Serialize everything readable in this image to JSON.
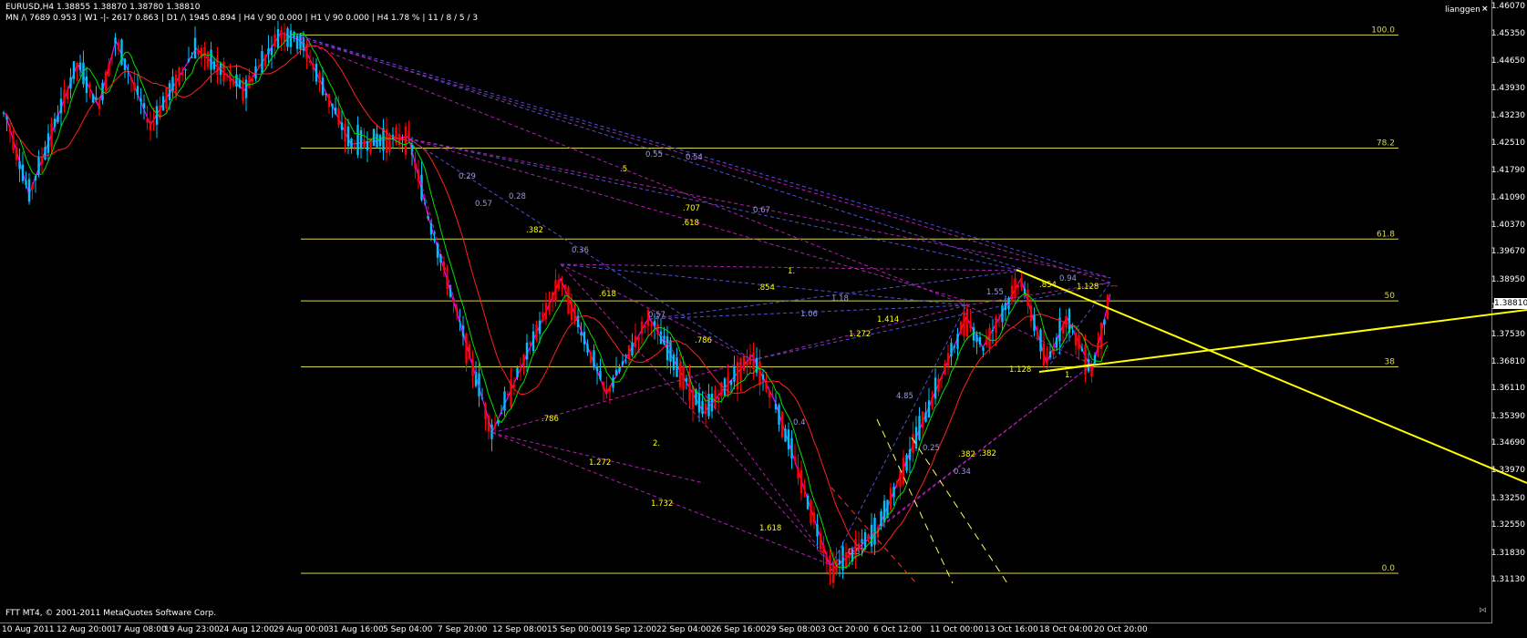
{
  "header": {
    "symbol_ohlc": "EURUSD,H4  1.38855 1.38870 1.38780 1.38810",
    "indicator": "MN /\\ 7689  0.953 | W1 -|- 2617  0.863 | D1 /\\ 1945  0.894 | H4 \\/ 90  0.000 | H1 \\/ 90  0.000 | H4  1.78 % | 11 / 8 / 5 / 3",
    "username": "lianggen",
    "close_glyph": "×"
  },
  "copyright": "FTT MT4, © 2001-2011 MetaQuotes Software Corp.",
  "price_axis": [
    "1.46070",
    "1.45350",
    "1.44650",
    "1.43930",
    "1.43230",
    "1.42510",
    "1.41790",
    "1.41090",
    "1.40370",
    "1.39670",
    "1.38950",
    "1.38230",
    "1.37530",
    "1.36810",
    "1.36110",
    "1.35390",
    "1.34690",
    "1.33970",
    "1.33250",
    "1.32550",
    "1.31830",
    "1.31130"
  ],
  "current_price": "1.38810",
  "date_axis": [
    "10 Aug 2011",
    "12 Aug 20:00",
    "17 Aug 08:00",
    "19 Aug 23:00",
    "24 Aug 12:00",
    "29 Aug 00:00",
    "31 Aug 16:00",
    "5 Sep 04:00",
    "7 Sep 20:00",
    "12 Sep 08:00",
    "15 Sep 00:00",
    "19 Sep 12:00",
    "22 Sep 04:00",
    "26 Sep 16:00",
    "29 Sep 08:00",
    "3 Oct 20:00",
    "6 Oct 12:00",
    "11 Oct 00:00",
    "13 Oct 16:00",
    "18 Oct 04:00",
    "20 Oct 20:00"
  ],
  "fib_levels": [
    {
      "label": "100.0",
      "price": 1.4535
    },
    {
      "label": "78.2",
      "price": 1.424
    },
    {
      "label": "61.8",
      "price": 1.4003
    },
    {
      "label": "50",
      "price": 1.3842
    },
    {
      "label": "38",
      "price": 1.367
    },
    {
      "label": "0.0",
      "price": 1.3132
    }
  ],
  "annotations": [
    {
      "text": "0.55",
      "color": "#9a9ae0"
    },
    {
      "text": "0.54",
      "color": "#9a9ae0"
    },
    {
      "text": ".5",
      "color": "#ffff00"
    },
    {
      "text": "0.29",
      "color": "#9a9ae0"
    },
    {
      "text": "0.28",
      "color": "#9a9ae0"
    },
    {
      "text": "0.57",
      "color": "#9a9ae0"
    },
    {
      "text": ".707",
      "color": "#ffff00"
    },
    {
      "text": "0.67",
      "color": "#9a9ae0"
    },
    {
      "text": ".618",
      "color": "#ffff00"
    },
    {
      "text": ".382",
      "color": "#ffff00"
    },
    {
      "text": "0.36",
      "color": "#9a9ae0"
    },
    {
      "text": "1.",
      "color": "#ffff00"
    },
    {
      "text": ".854",
      "color": "#ffff00"
    },
    {
      "text": ".618",
      "color": "#ffff00"
    },
    {
      "text": "1.18",
      "color": "#9a9ae0"
    },
    {
      "text": "1.06",
      "color": "#9a9ae0"
    },
    {
      "text": "0.57",
      "color": "#9a9ae0"
    },
    {
      "text": "1.414",
      "color": "#ffff00"
    },
    {
      "text": "1.272",
      "color": "#ffff00"
    },
    {
      "text": ".786",
      "color": "#ffff00"
    },
    {
      "text": "1.55",
      "color": "#9a9ae0"
    },
    {
      "text": ".854",
      "color": "#ffff00"
    },
    {
      "text": "0.94",
      "color": "#9a9ae0"
    },
    {
      "text": "1.128",
      "color": "#ffff00"
    },
    {
      "text": "1.128",
      "color": "#ffff00"
    },
    {
      "text": "1.",
      "color": "#ffff00"
    },
    {
      "text": ".786",
      "color": "#ffff00"
    },
    {
      "text": "4.85",
      "color": "#9a9ae0"
    },
    {
      "text": "0.4",
      "color": "#9a9ae0"
    },
    {
      "text": "2.",
      "color": "#ffff00"
    },
    {
      "text": "1.272",
      "color": "#ffff00"
    },
    {
      "text": "0.25",
      "color": "#9a9ae0"
    },
    {
      "text": ".382",
      "color": "#ffff00"
    },
    {
      "text": ".382",
      "color": "#ffff00"
    },
    {
      "text": "0.34",
      "color": "#9a9ae0"
    },
    {
      "text": "1.732",
      "color": "#ffff00"
    },
    {
      "text": "1.618",
      "color": "#ffff00"
    },
    {
      "text": "0.57",
      "color": "#9a9ae0"
    }
  ],
  "colors": {
    "background": "#000000",
    "bull": "#00bfff",
    "bear": "#ff0000",
    "zigzag": "#ff00ff",
    "fib": "#d8d850",
    "ma_fast": "#00e000",
    "ma_slow": "#ff2020",
    "trend": "#ffff00",
    "pattern": "#b020b0",
    "pattern2": "#5050d0",
    "axis_text": "#ffffff"
  },
  "icons": {
    "scroll_marker": "scroll-end-icon"
  }
}
